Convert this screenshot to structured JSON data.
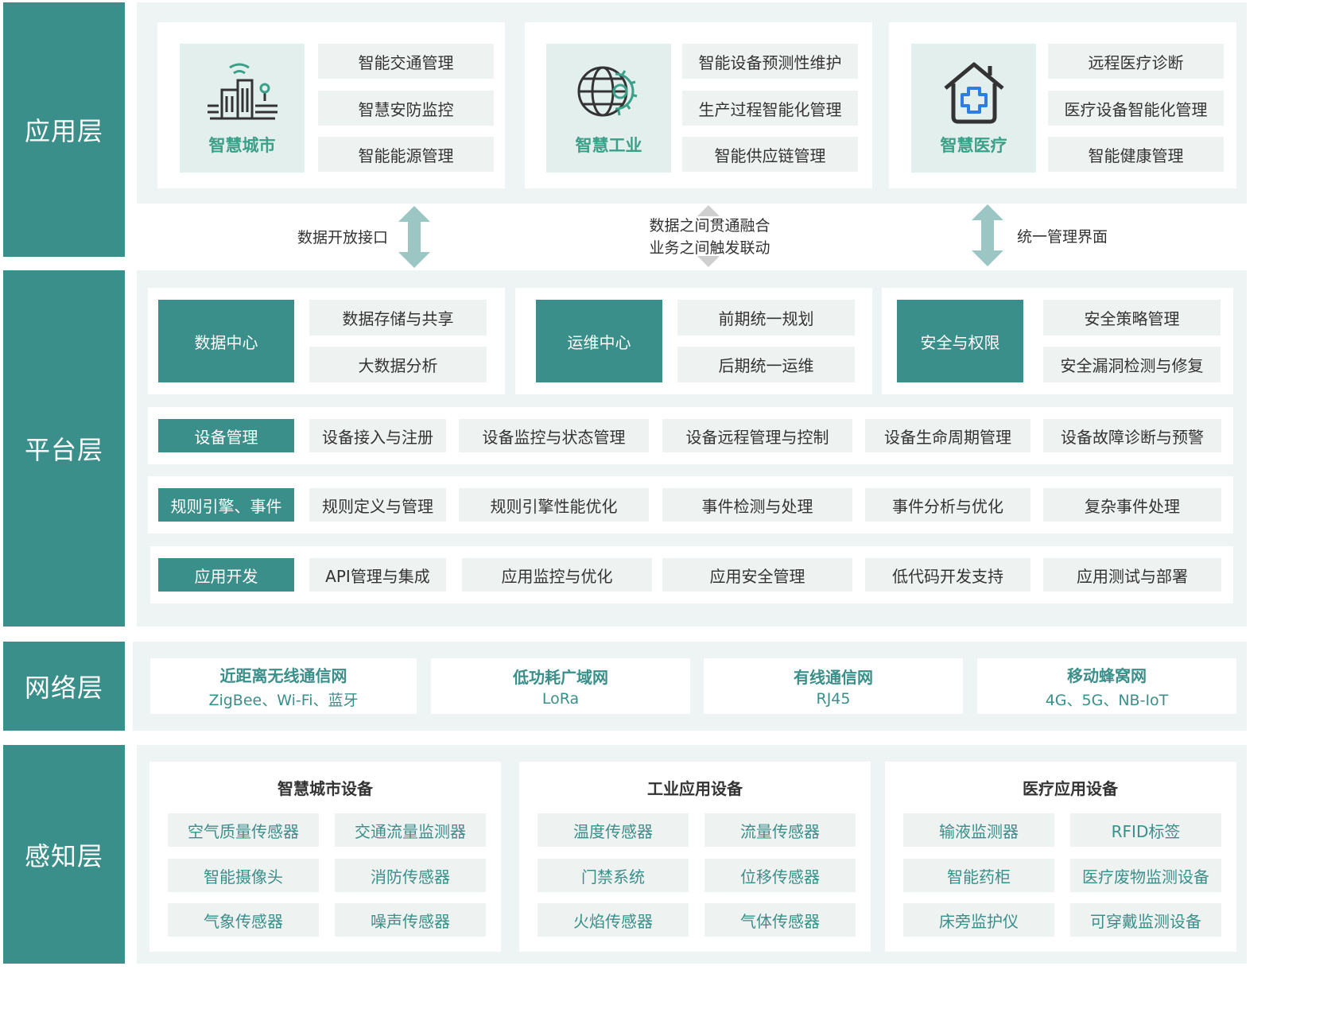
{
  "colors": {
    "accent": "#3a8f8a",
    "panel": "#eef4f3",
    "cell": "#eef2f1",
    "icon_green": "#3aa088",
    "arrow": "#9cc6c3"
  },
  "layers": {
    "app": "应用层",
    "platform": "平台层",
    "network": "网络层",
    "perception": "感知层"
  },
  "app_layer": {
    "groups": [
      {
        "icon": "smart-city-icon",
        "name": "智慧城市",
        "items": [
          "智能交通管理",
          "智慧安防监控",
          "智能能源管理"
        ]
      },
      {
        "icon": "globe-gear-icon",
        "name": "智慧工业",
        "items": [
          "智能设备预测性维护",
          "生产过程智能化管理",
          "智能供应链管理"
        ]
      },
      {
        "icon": "house-medical-icon",
        "name": "智慧医疗",
        "items": [
          "远程医疗诊断",
          "医疗设备智能化管理",
          "智能健康管理"
        ]
      }
    ]
  },
  "connectors": {
    "left": "数据开放接口",
    "middle_line1": "数据之间贯通融合",
    "middle_line2": "业务之间触发联动",
    "right": "统一管理界面"
  },
  "platform_layer": {
    "top_groups": [
      {
        "title": "数据中心",
        "items": [
          "数据存储与共享",
          "大数据分析"
        ]
      },
      {
        "title": "运维中心",
        "items": [
          "前期统一规划",
          "后期统一运维"
        ]
      },
      {
        "title": "安全与权限",
        "items": [
          "安全策略管理",
          "安全漏洞检测与修复"
        ]
      }
    ],
    "rows": [
      {
        "title": "设备管理",
        "items": [
          "设备接入与注册",
          "设备监控与状态管理",
          "设备远程管理与控制",
          "设备生命周期管理",
          "设备故障诊断与预警"
        ]
      },
      {
        "title": "规则引擎、事件",
        "items": [
          "规则定义与管理",
          "规则引擎性能优化",
          "事件检测与处理",
          "事件分析与优化",
          "复杂事件处理"
        ]
      },
      {
        "title": "应用开发",
        "items": [
          "API管理与集成",
          "应用监控与优化",
          "应用安全管理",
          "低代码开发支持",
          "应用测试与部署"
        ]
      }
    ]
  },
  "network_layer": {
    "items": [
      {
        "title": "近距离无线通信网",
        "sub": "ZigBee、Wi-Fi、蓝牙"
      },
      {
        "title": "低功耗广域网",
        "sub": "LoRa"
      },
      {
        "title": "有线通信网",
        "sub": "RJ45"
      },
      {
        "title": "移动蜂窝网",
        "sub": "4G、5G、NB-IoT"
      }
    ]
  },
  "perception_layer": {
    "groups": [
      {
        "title": "智慧城市设备",
        "items": [
          "空气质量传感器",
          "交通流量监测器",
          "智能摄像头",
          "消防传感器",
          "气象传感器",
          "噪声传感器"
        ]
      },
      {
        "title": "工业应用设备",
        "items": [
          "温度传感器",
          "流量传感器",
          "门禁系统",
          "位移传感器",
          "火焰传感器",
          "气体传感器"
        ]
      },
      {
        "title": "医疗应用设备",
        "items": [
          "输液监测器",
          "RFID标签",
          "智能药柜",
          "医疗废物监测设备",
          "床旁监护仪",
          "可穿戴监测设备"
        ]
      }
    ]
  }
}
